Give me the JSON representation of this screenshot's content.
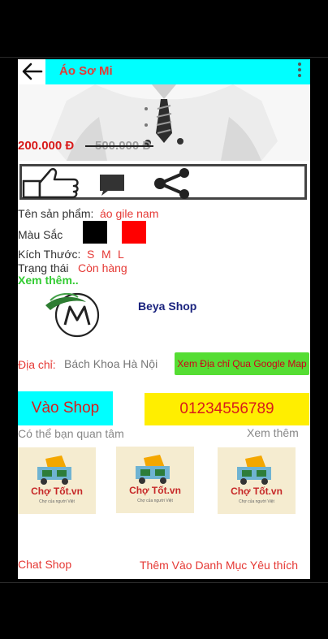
{
  "app_bar": {
    "title": "Áo Sơ Mi"
  },
  "product": {
    "price_new": "200.000 Đ",
    "price_old": "500.000 Đ",
    "name_label": "Tên sản phẩm:",
    "name_value": "áo gile nam",
    "color_label": "Màu Sắc",
    "colors": [
      "#000000",
      "#ff0000"
    ],
    "size_label": "Kích Thước:",
    "sizes": [
      "S",
      "M",
      "L"
    ],
    "status_label": "Trạng thái",
    "status_value": "Còn hàng",
    "see_more": "Xem thêm.."
  },
  "shop": {
    "name": "Beya Shop",
    "address_label": "Địa chỉ:",
    "address_value": "Bách Khoa Hà Nội",
    "map_button": "Xem Địa chỉ Qua Google Map",
    "visit_button": "Vào Shop",
    "phone": "01234556789"
  },
  "related": {
    "title": "Có thể bạn quan tâm",
    "see_more": "Xem thêm",
    "logo_text": "Chợ Tốt.vn",
    "logo_tagline": "Chợ của người Việt"
  },
  "footer": {
    "chat": "Chat Shop",
    "favorite": "Thêm Vào Danh Mục Yêu thích"
  },
  "icons": {
    "back": "arrow-left-icon",
    "more": "more-vert-icon",
    "like": "thumbs-up-icon",
    "comment": "comment-icon",
    "share": "share-icon"
  },
  "colors": {
    "accent_cyan": "#00ffff",
    "price_red": "#d81b1b",
    "link_green": "#33cc33",
    "phone_yellow": "#ffee00",
    "map_green": "#55dd33"
  }
}
